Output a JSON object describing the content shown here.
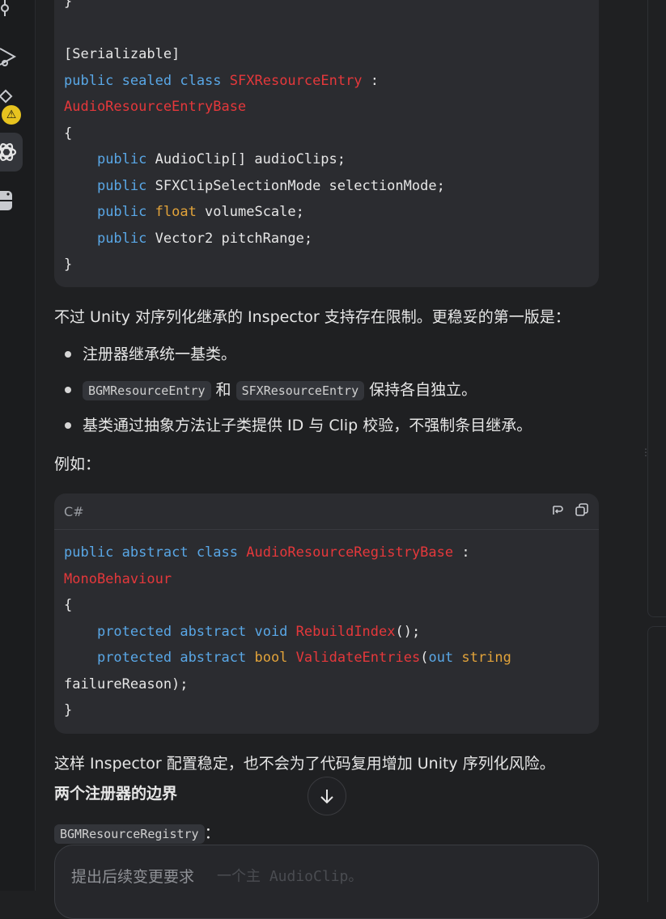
{
  "code_top": {
    "lines": [
      [
        {
          "t": "}",
          "c": ""
        }
      ],
      [
        {
          "t": "",
          "c": ""
        }
      ],
      [
        {
          "t": "[Serializable]",
          "c": ""
        }
      ],
      [
        {
          "t": "public",
          "c": "kw"
        },
        {
          "t": " ",
          "c": ""
        },
        {
          "t": "sealed",
          "c": "kw"
        },
        {
          "t": " ",
          "c": ""
        },
        {
          "t": "class",
          "c": "kw"
        },
        {
          "t": " ",
          "c": ""
        },
        {
          "t": "SFXResourceEntry",
          "c": "ty"
        },
        {
          "t": " :",
          "c": ""
        }
      ],
      [
        {
          "t": "AudioResourceEntryBase",
          "c": "ty"
        }
      ],
      [
        {
          "t": "{",
          "c": ""
        }
      ],
      [
        {
          "t": "    ",
          "c": ""
        },
        {
          "t": "public",
          "c": "kw"
        },
        {
          "t": " AudioClip[] audioClips;",
          "c": ""
        }
      ],
      [
        {
          "t": "    ",
          "c": ""
        },
        {
          "t": "public",
          "c": "kw"
        },
        {
          "t": " SFXClipSelectionMode selectionMode;",
          "c": ""
        }
      ],
      [
        {
          "t": "    ",
          "c": ""
        },
        {
          "t": "public",
          "c": "kw"
        },
        {
          "t": " ",
          "c": ""
        },
        {
          "t": "float",
          "c": "pr"
        },
        {
          "t": " volumeScale;",
          "c": ""
        }
      ],
      [
        {
          "t": "    ",
          "c": ""
        },
        {
          "t": "public",
          "c": "kw"
        },
        {
          "t": " Vector2 pitchRange;",
          "c": ""
        }
      ],
      [
        {
          "t": "}",
          "c": ""
        }
      ]
    ]
  },
  "para1": "不过 Unity 对序列化继承的 Inspector 支持存在限制。更稳妥的第一版是：",
  "bullets": {
    "b1": "注册器继承统一基类。",
    "b2_code1": "BGMResourceEntry",
    "b2_mid": "和",
    "b2_code2": "SFXResourceEntry",
    "b2_tail": "保持各自独立。",
    "b3": "基类通过抽象方法让子类提供 ID 与 Clip 校验，不强制条目继承。"
  },
  "para2": "例如：",
  "code_second": {
    "lang": "C#",
    "lines": [
      [
        {
          "t": "public",
          "c": "kw"
        },
        {
          "t": " ",
          "c": ""
        },
        {
          "t": "abstract",
          "c": "kw"
        },
        {
          "t": " ",
          "c": ""
        },
        {
          "t": "class",
          "c": "kw"
        },
        {
          "t": " ",
          "c": ""
        },
        {
          "t": "AudioResourceRegistryBase",
          "c": "ty"
        },
        {
          "t": " :",
          "c": ""
        }
      ],
      [
        {
          "t": "MonoBehaviour",
          "c": "ty"
        }
      ],
      [
        {
          "t": "{",
          "c": ""
        }
      ],
      [
        {
          "t": "    ",
          "c": ""
        },
        {
          "t": "protected",
          "c": "kw"
        },
        {
          "t": " ",
          "c": ""
        },
        {
          "t": "abstract",
          "c": "kw"
        },
        {
          "t": " ",
          "c": ""
        },
        {
          "t": "void",
          "c": "kw"
        },
        {
          "t": " ",
          "c": ""
        },
        {
          "t": "RebuildIndex",
          "c": "ty"
        },
        {
          "t": "();",
          "c": ""
        }
      ],
      [
        {
          "t": "    ",
          "c": ""
        },
        {
          "t": "protected",
          "c": "kw"
        },
        {
          "t": " ",
          "c": ""
        },
        {
          "t": "abstract",
          "c": "kw"
        },
        {
          "t": " ",
          "c": ""
        },
        {
          "t": "bool",
          "c": "pr"
        },
        {
          "t": " ",
          "c": ""
        },
        {
          "t": "ValidateEntries",
          "c": "ty"
        },
        {
          "t": "(",
          "c": ""
        },
        {
          "t": "out",
          "c": "kw"
        },
        {
          "t": " ",
          "c": ""
        },
        {
          "t": "string",
          "c": "pr"
        }
      ],
      [
        {
          "t": "failureReason);",
          "c": ""
        }
      ],
      [
        {
          "t": "}",
          "c": ""
        }
      ]
    ]
  },
  "para3": "这样 Inspector 配置稳定，也不会为了代码复用增加 Unity 序列化风险。",
  "heading": "两个注册器的边界",
  "registry_code": "BGMResourceRegistry",
  "registry_colon": "：",
  "input": {
    "placeholder": "提出后续变更要求",
    "behind_text": "一个主 AudioClip。"
  },
  "colors": {
    "keyword": "#59a7e6",
    "type": "#e5383b",
    "primitive": "#e2a33a",
    "warning": "#e7c31f"
  }
}
